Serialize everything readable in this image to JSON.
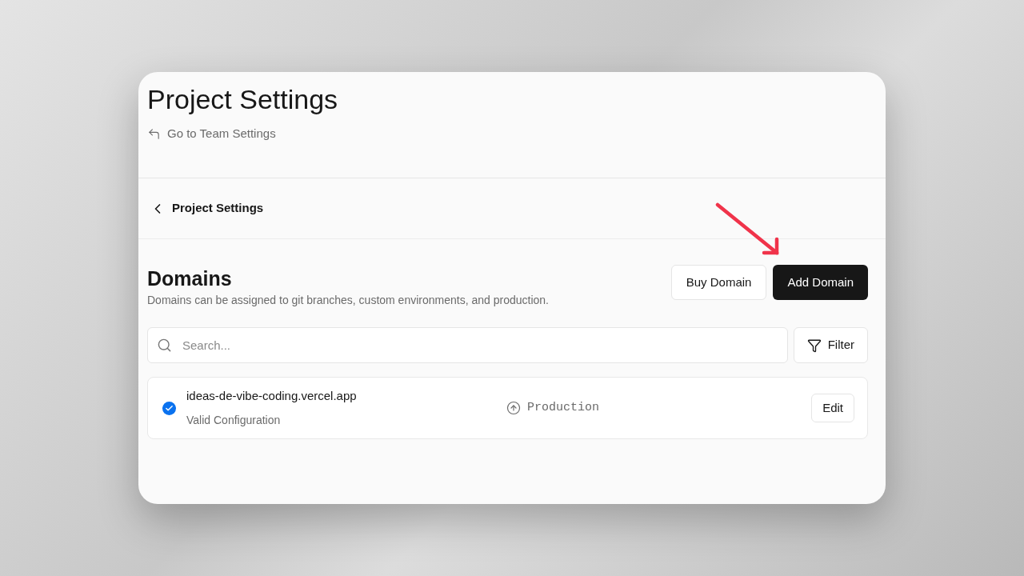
{
  "header": {
    "title": "Project Settings",
    "back_link": "Go to Team Settings"
  },
  "nav": {
    "label": "Project Settings"
  },
  "section": {
    "title": "Domains",
    "description": "Domains can be assigned to git branches, custom environments, and production.",
    "buttons": [
      {
        "label": "Buy Domain",
        "kind": "secondary"
      },
      {
        "label": "Add Domain",
        "kind": "primary"
      }
    ]
  },
  "search": {
    "placeholder": "Search..."
  },
  "filter_button": "Filter",
  "domains": [
    {
      "name": "ideas-de-vibe-coding.vercel.app",
      "status": "Valid Configuration",
      "valid": true,
      "environment": "Production",
      "action": "Edit"
    }
  ]
}
